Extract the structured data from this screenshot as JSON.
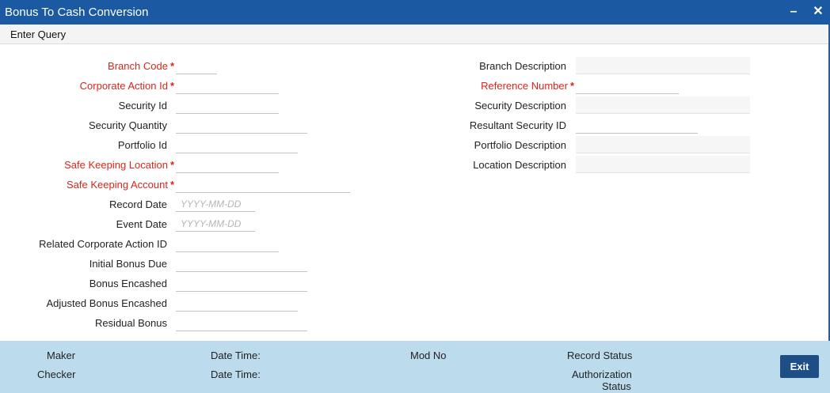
{
  "window": {
    "title": "Bonus To Cash Conversion",
    "minimize_glyph": "–",
    "close_glyph": "✕"
  },
  "toolbar": {
    "enter_query": "Enter Query"
  },
  "left_fields": [
    {
      "label": "Branch Code",
      "required": true,
      "value": "",
      "placeholder": ""
    },
    {
      "label": "Corporate Action Id",
      "required": true,
      "value": "",
      "placeholder": ""
    },
    {
      "label": "Security Id",
      "required": false,
      "value": "",
      "placeholder": ""
    },
    {
      "label": "Security Quantity",
      "required": false,
      "value": "",
      "placeholder": ""
    },
    {
      "label": "Portfolio Id",
      "required": false,
      "value": "",
      "placeholder": ""
    },
    {
      "label": "Safe Keeping Location",
      "required": true,
      "value": "",
      "placeholder": ""
    },
    {
      "label": "Safe Keeping Account",
      "required": true,
      "value": "",
      "placeholder": ""
    },
    {
      "label": "Record Date",
      "required": false,
      "value": "",
      "placeholder": "YYYY-MM-DD"
    },
    {
      "label": "Event Date",
      "required": false,
      "value": "",
      "placeholder": "YYYY-MM-DD"
    },
    {
      "label": "Related Corporate Action ID",
      "required": false,
      "value": "",
      "placeholder": ""
    },
    {
      "label": "Initial Bonus Due",
      "required": false,
      "value": "",
      "placeholder": ""
    },
    {
      "label": "Bonus Encashed",
      "required": false,
      "value": "",
      "placeholder": ""
    },
    {
      "label": "Adjusted Bonus Encashed",
      "required": false,
      "value": "",
      "placeholder": ""
    },
    {
      "label": "Residual Bonus",
      "required": false,
      "value": "",
      "placeholder": ""
    }
  ],
  "right_fields": [
    {
      "label": "Branch Description",
      "required": false,
      "readonly": true
    },
    {
      "label": "Reference Number",
      "required": true,
      "readonly": false
    },
    {
      "label": "Security Description",
      "required": false,
      "readonly": true
    },
    {
      "label": "Resultant Security ID",
      "required": false,
      "readonly": false
    },
    {
      "label": "Portfolio Description",
      "required": false,
      "readonly": true
    },
    {
      "label": "Location Description",
      "required": false,
      "readonly": true
    }
  ],
  "required_marker": "*",
  "footer": {
    "maker": "Maker",
    "checker": "Checker",
    "date_time_1": "Date Time:",
    "date_time_2": "Date Time:",
    "mod_no": "Mod No",
    "record_status": "Record Status",
    "authorization_status_line1": "Authorization",
    "authorization_status_line2": "Status",
    "exit": "Exit"
  },
  "colors": {
    "title_bar": "#1b5aa3",
    "required_label": "#d9261c",
    "footer_bg": "#bcdcee",
    "exit_button": "#1d4f86"
  }
}
